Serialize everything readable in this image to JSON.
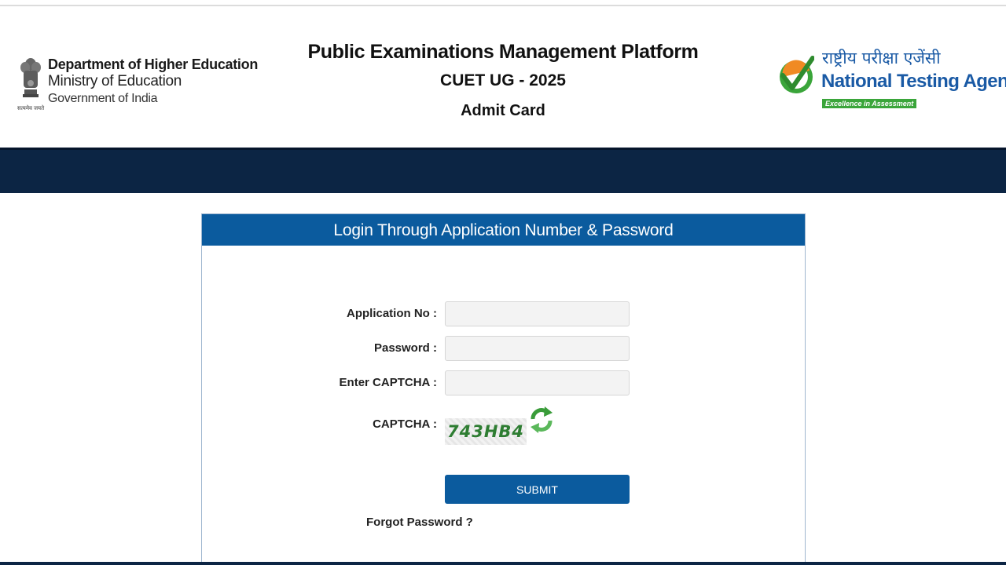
{
  "header": {
    "department": {
      "line1": "Department of Higher Education",
      "line2": "Ministry of Education",
      "line3": "Government of India",
      "emblem_caption": "सत्यमेव जयते"
    },
    "titles": {
      "platform": "Public Examinations Management Platform",
      "exam": "CUET UG - 2025",
      "page": "Admit Card"
    },
    "agency": {
      "hindi_name": "राष्ट्रीय परीक्षा एजेंसी",
      "english_name": "National Testing Agency",
      "tagline": "Excellence in Assessment"
    }
  },
  "login_panel": {
    "heading": "Login Through Application Number & Password",
    "fields": {
      "application_no": {
        "label": "Application No :",
        "value": "",
        "placeholder": ""
      },
      "password": {
        "label": "Password :",
        "value": "",
        "placeholder": ""
      },
      "captcha_input": {
        "label": "Enter CAPTCHA :",
        "value": "",
        "placeholder": ""
      }
    },
    "captcha": {
      "label": "CAPTCHA :",
      "code": "743HB4"
    },
    "submit_label": "SUBMIT",
    "forgot_password": "Forgot Password ?"
  },
  "colors": {
    "navbar": "#0c2544",
    "panel_header": "#0b5b9e",
    "agency_blue": "#1a5aa5",
    "agency_green": "#3aa53a",
    "captcha_green": "#2e7d32"
  },
  "icons": [
    "national-emblem-icon",
    "nta-checkmark-logo-icon",
    "refresh-captcha-icon"
  ]
}
